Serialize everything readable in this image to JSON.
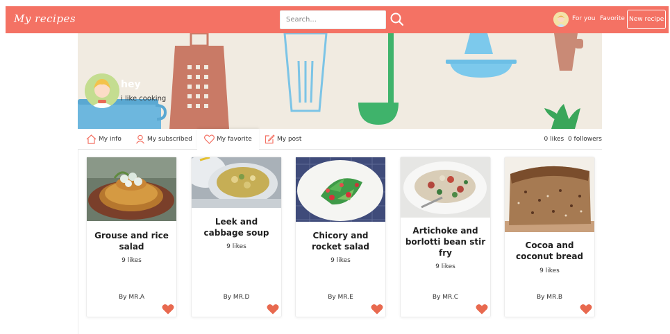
{
  "app": {
    "title": "My recipes"
  },
  "search": {
    "placeholder": "Search..."
  },
  "nav": {
    "for_you": "For you",
    "favorite": "Favorite",
    "new_recipe": "New recipe"
  },
  "profile": {
    "name": "hey",
    "bio": "i like cooking"
  },
  "tabs": [
    {
      "label": "My info",
      "icon": "home-icon"
    },
    {
      "label": "My subscribed",
      "icon": "user-icon"
    },
    {
      "label": "My favorite",
      "icon": "heart-outline-icon",
      "active": true
    },
    {
      "label": "My post",
      "icon": "edit-icon"
    }
  ],
  "stats": {
    "likes": "0 likes",
    "followers": "0 followers"
  },
  "recipes": [
    {
      "title": "Grouse and rice salad",
      "likes": "9 likes",
      "author": "By MR.A"
    },
    {
      "title": "Leek and cabbage soup",
      "likes": "9 likes",
      "author": "By MR.D"
    },
    {
      "title": "Chicory and rocket salad",
      "likes": "9 likes",
      "author": "By MR.E"
    },
    {
      "title": "Artichoke and borlotti bean stir fry",
      "likes": "9 likes",
      "author": "By MR.C"
    },
    {
      "title": "Cocoa and coconut bread",
      "likes": "9 likes",
      "author": "By MR.B"
    }
  ],
  "colors": {
    "brand": "#f47264",
    "heart": "#e8694f",
    "banner_bg": "#f1ebe1"
  }
}
